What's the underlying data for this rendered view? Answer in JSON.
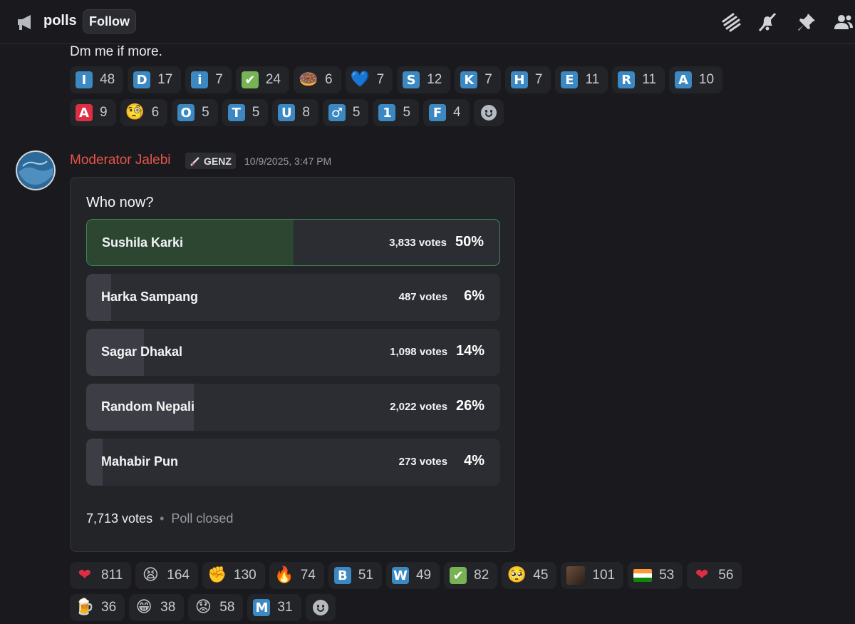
{
  "header": {
    "channel_name": "polls",
    "follow_label": "Follow",
    "icons": [
      "announcement-icon",
      "threads-icon",
      "mute-notifications-icon",
      "pin-icon",
      "members-icon"
    ]
  },
  "previous_message": {
    "text": "Dm me if more.",
    "reactions_row1": [
      {
        "emoji": "I",
        "kind": "letter",
        "count": "48"
      },
      {
        "emoji": "D",
        "kind": "letter",
        "count": "17"
      },
      {
        "emoji": "i",
        "kind": "letter",
        "count": "7"
      },
      {
        "emoji": "✔",
        "kind": "check",
        "count": "24"
      },
      {
        "emoji": "🍩",
        "kind": "emoji",
        "count": "6"
      },
      {
        "emoji": "💙",
        "kind": "emoji",
        "count": "7"
      },
      {
        "emoji": "S",
        "kind": "letter",
        "count": "12"
      },
      {
        "emoji": "K",
        "kind": "letter",
        "count": "7"
      },
      {
        "emoji": "H",
        "kind": "letter",
        "count": "7"
      },
      {
        "emoji": "E",
        "kind": "letter",
        "count": "11"
      },
      {
        "emoji": "R",
        "kind": "letter",
        "count": "11"
      },
      {
        "emoji": "A",
        "kind": "letter",
        "count": "10"
      }
    ],
    "reactions_row2": [
      {
        "emoji": "A",
        "kind": "letter-red",
        "count": "9"
      },
      {
        "emoji": "🧐",
        "kind": "emoji",
        "count": "6"
      },
      {
        "emoji": "O",
        "kind": "letter",
        "count": "5"
      },
      {
        "emoji": "T",
        "kind": "letter",
        "count": "5"
      },
      {
        "emoji": "U",
        "kind": "letter",
        "count": "8"
      },
      {
        "emoji": "♂",
        "kind": "letter",
        "count": "5"
      },
      {
        "emoji": "1",
        "kind": "letter",
        "count": "5"
      },
      {
        "emoji": "F",
        "kind": "letter",
        "count": "4"
      }
    ]
  },
  "message": {
    "author": "Moderator Jalebi",
    "role_tag": "GENZ",
    "timestamp": "10/9/2025, 3:47 PM",
    "author_color": "#e3554a"
  },
  "poll": {
    "question": "Who now?",
    "answers": [
      {
        "label": "Sushila Karki",
        "votes": "3,833 votes",
        "percent": "50%",
        "fraction": 0.5,
        "winner": true
      },
      {
        "label": "Harka Sampang",
        "votes": "487 votes",
        "percent": "6%",
        "fraction": 0.06,
        "winner": false
      },
      {
        "label": "Sagar Dhakal",
        "votes": "1,098 votes",
        "percent": "14%",
        "fraction": 0.14,
        "winner": false
      },
      {
        "label": "Random Nepali",
        "votes": "2,022 votes",
        "percent": "26%",
        "fraction": 0.26,
        "winner": false
      },
      {
        "label": "Mahabir Pun",
        "votes": "273 votes",
        "percent": "4%",
        "fraction": 0.04,
        "winner": false
      }
    ],
    "total_votes": "7,713 votes",
    "separator": "•",
    "status": "Poll closed"
  },
  "poll_reactions_row1": [
    {
      "emoji": "❤",
      "kind": "heart",
      "count": "811"
    },
    {
      "emoji": "😫",
      "kind": "emoji",
      "count": "164"
    },
    {
      "emoji": "✊",
      "kind": "emoji",
      "count": "130"
    },
    {
      "emoji": "🔥",
      "kind": "emoji",
      "count": "74"
    },
    {
      "emoji": "B",
      "kind": "letter",
      "count": "51"
    },
    {
      "emoji": "W",
      "kind": "letter",
      "count": "49"
    },
    {
      "emoji": "✔",
      "kind": "check",
      "count": "82"
    },
    {
      "emoji": "🥺",
      "kind": "emoji",
      "count": "45"
    },
    {
      "emoji": "",
      "kind": "custom",
      "count": "101"
    },
    {
      "emoji": "",
      "kind": "flag-india",
      "count": "53"
    },
    {
      "emoji": "❤",
      "kind": "heart",
      "count": "56"
    }
  ],
  "poll_reactions_row2": [
    {
      "emoji": "🍺",
      "kind": "emoji",
      "count": "36"
    },
    {
      "emoji": "😁",
      "kind": "emoji",
      "count": "38"
    },
    {
      "emoji": "😟",
      "kind": "emoji",
      "count": "58"
    },
    {
      "emoji": "M",
      "kind": "letter",
      "count": "31"
    }
  ],
  "colors": {
    "background": "#1a1a1e",
    "poll_bg": "#232428",
    "winner_border": "#3c8a4e",
    "letter_blue": "#3b88c3"
  }
}
